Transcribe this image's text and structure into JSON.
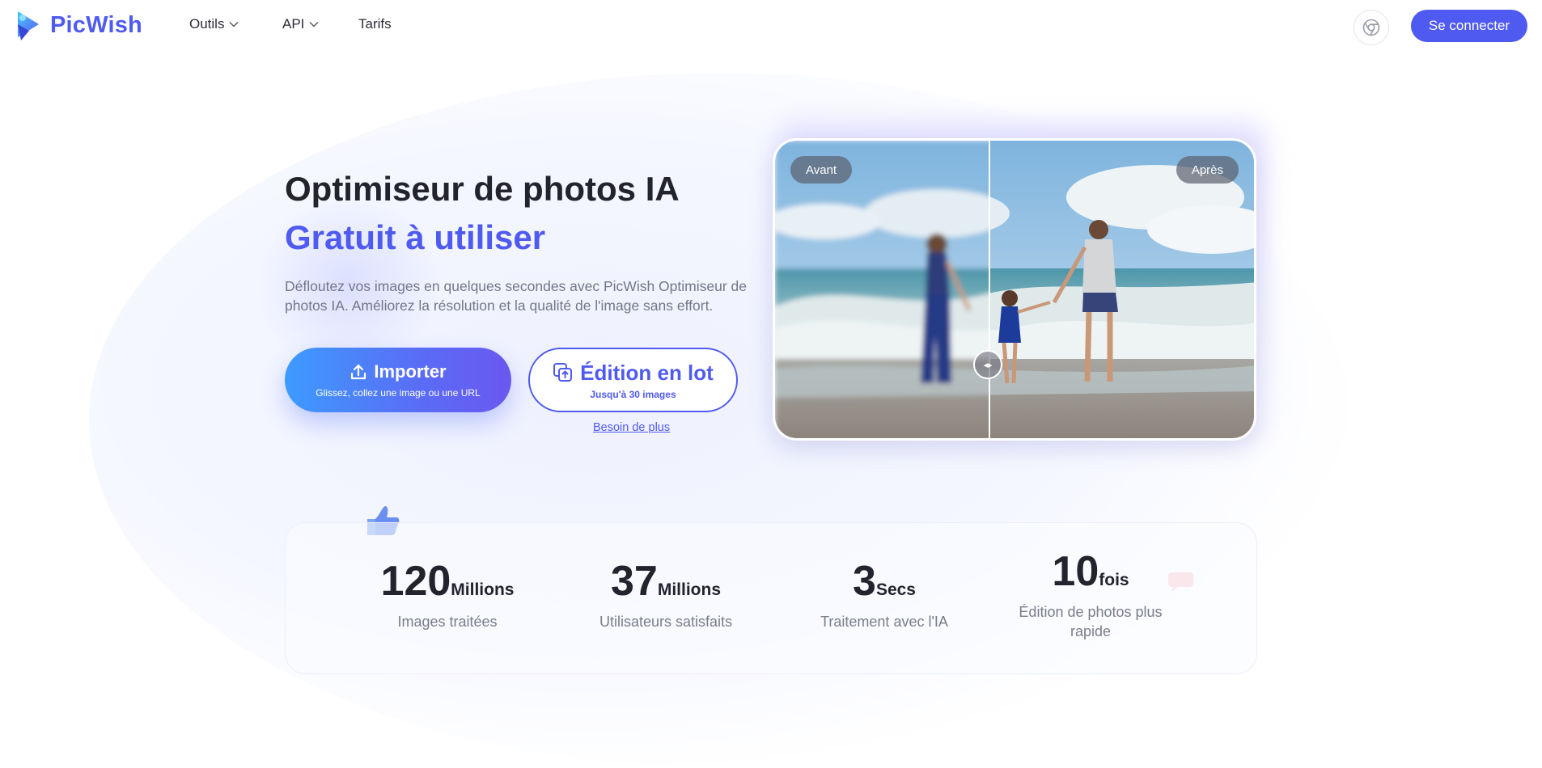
{
  "brand": {
    "name": "PicWish",
    "color": "#4f5af0"
  },
  "nav": {
    "items": [
      {
        "label": "Outils",
        "has_dropdown": true
      },
      {
        "label": "API",
        "has_dropdown": true
      },
      {
        "label": "Tarifs",
        "has_dropdown": false
      }
    ],
    "extension_icon": "chrome-icon",
    "login_label": "Se connecter"
  },
  "hero": {
    "title": "Optimiseur de photos IA",
    "subtitle": "Gratuit à utiliser",
    "description": "Défloutez vos images en quelques secondes avec PicWish Optimiseur de photos IA. Améliorez la résolution et la qualité de l'image sans effort.",
    "import_button": {
      "label": "Importer",
      "hint": "Glissez, collez une image ou une URL",
      "icon": "upload-icon"
    },
    "batch_button": {
      "label": "Édition en lot",
      "hint": "Jusqu'à 30 images",
      "icon": "batch-upload-icon"
    },
    "more_link": "Besoin de plus"
  },
  "compare": {
    "before_label": "Avant",
    "after_label": "Après",
    "handle_icon": "compare-handle-icon"
  },
  "stats": [
    {
      "number": "120",
      "unit": "Millions",
      "label": "Images traitées"
    },
    {
      "number": "37",
      "unit": "Millions",
      "label": "Utilisateurs satisfaits"
    },
    {
      "number": "3",
      "unit": "Secs",
      "label": "Traitement avec l'IA"
    },
    {
      "number": "10",
      "unit": "fois",
      "label": "Édition de photos plus rapide"
    }
  ]
}
